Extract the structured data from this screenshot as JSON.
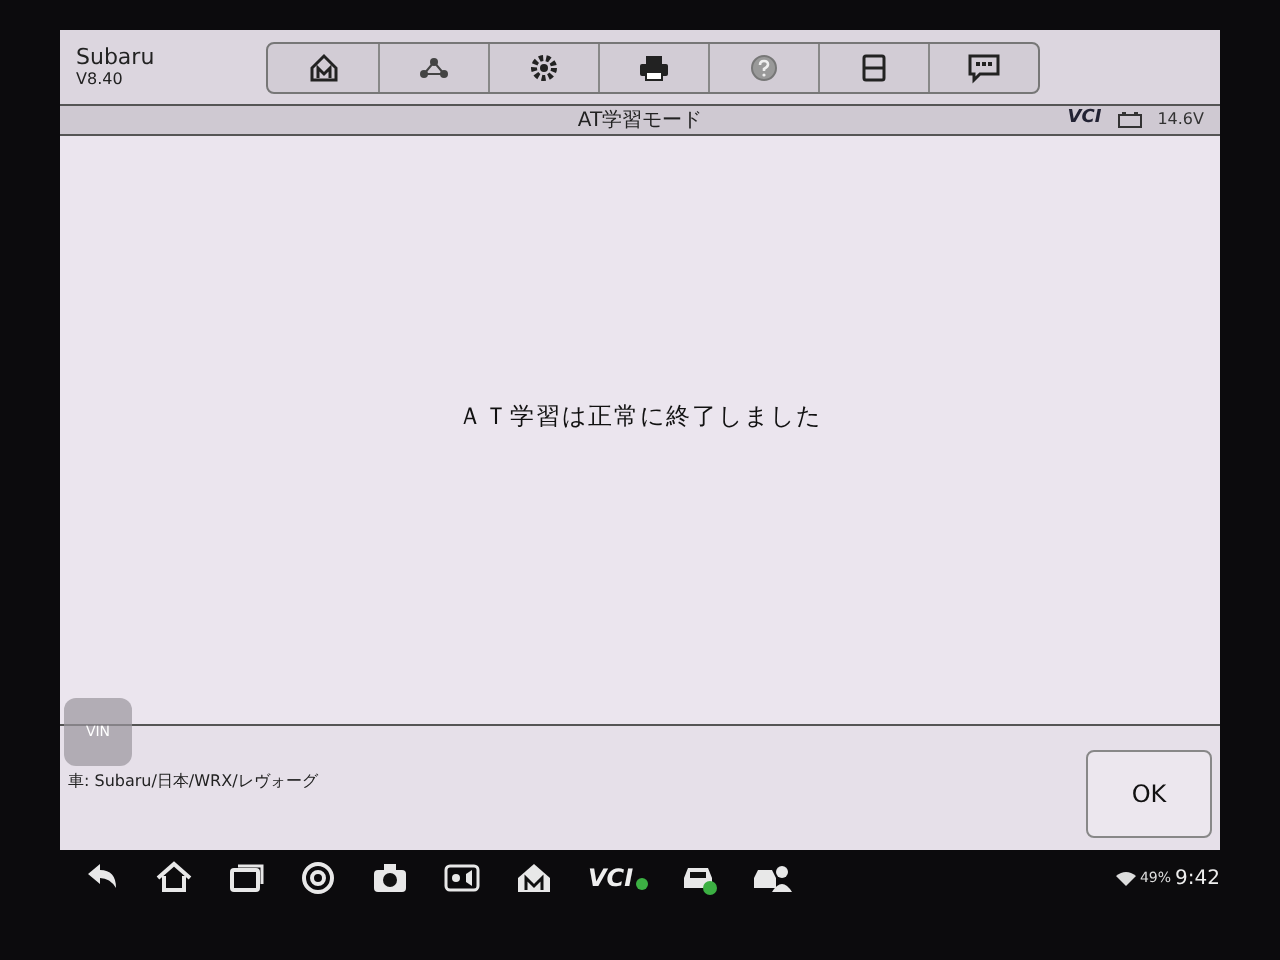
{
  "app": {
    "name": "Subaru",
    "version": "V8.40"
  },
  "toolbar": [
    {
      "kind": "home"
    },
    {
      "kind": "network"
    },
    {
      "kind": "gear"
    },
    {
      "kind": "printer"
    },
    {
      "kind": "help"
    },
    {
      "kind": "save"
    },
    {
      "kind": "chat"
    }
  ],
  "title_bar": {
    "title": "AT学習モード",
    "vci": "VCI",
    "voltage": "14.6V"
  },
  "message": "ＡＴ学習は正常に終了しました",
  "footer": {
    "vin": "VIN",
    "path": "車: Subaru/日本/WRX/レヴォーグ",
    "button": "OK"
  },
  "taskbar": [
    {
      "kind": "back"
    },
    {
      "kind": "home"
    },
    {
      "kind": "recents"
    },
    {
      "kind": "browser"
    },
    {
      "kind": "camera"
    },
    {
      "kind": "display"
    },
    {
      "kind": "home-m"
    },
    {
      "kind": "vci",
      "label": "VCI"
    },
    {
      "kind": "car"
    },
    {
      "kind": "support"
    }
  ],
  "status": {
    "battery": "49%",
    "time": "9:42"
  }
}
